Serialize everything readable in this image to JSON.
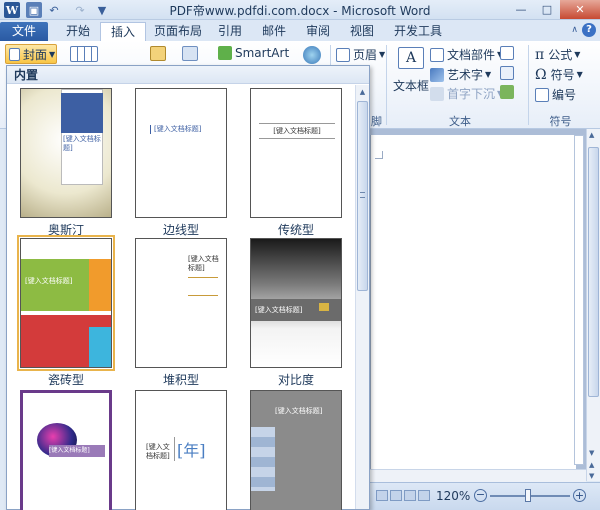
{
  "window": {
    "title": "PDF帝www.pdfdi.com.docx - Microsoft Word",
    "app_icon_letter": "W",
    "controls": {
      "minimize": "—",
      "maximize": "□",
      "close": "✕"
    },
    "ribbon_minimize": "∧",
    "help": "?"
  },
  "tabs": [
    {
      "label": "文件"
    },
    {
      "label": "开始"
    },
    {
      "label": "插入"
    },
    {
      "label": "页面布局"
    },
    {
      "label": "引用"
    },
    {
      "label": "邮件"
    },
    {
      "label": "审阅"
    },
    {
      "label": "视图"
    },
    {
      "label": "开发工具"
    }
  ],
  "ribbon": {
    "cover_button": "封面",
    "smartart": "SmartArt",
    "header": "页眉",
    "footer_partial": "脚",
    "text_box": "文本框",
    "quick_parts": "文档部件",
    "wordart": "艺术字",
    "drop_cap": "首字下沉",
    "equation": "公式",
    "symbol": "符号",
    "numbering": "编号",
    "group_text": "文本",
    "group_symbols": "符号"
  },
  "gallery": {
    "header": "内置",
    "items": [
      {
        "label": "奥斯汀",
        "title_text": "[键入文档标题]"
      },
      {
        "label": "边线型",
        "title_text": "[键入文档标题]"
      },
      {
        "label": "传统型",
        "title_text": "[键入文档标题]"
      },
      {
        "label": "瓷砖型",
        "title_text": "[键入文档标题]"
      },
      {
        "label": "堆积型",
        "title_text": "[键入文档标题]"
      },
      {
        "label": "对比度",
        "title_text": "[键入文档标题]"
      },
      {
        "label": "",
        "title_text": "[键入文档标题]"
      },
      {
        "label": "",
        "title_text": "[键入文档标题]",
        "year_text": "[年]"
      },
      {
        "label": "",
        "title_text": "[键入文档标题]"
      }
    ]
  },
  "status": {
    "zoom": "120%"
  },
  "colors": {
    "accent": "#2a5aa3",
    "hover": "#f9c646"
  }
}
